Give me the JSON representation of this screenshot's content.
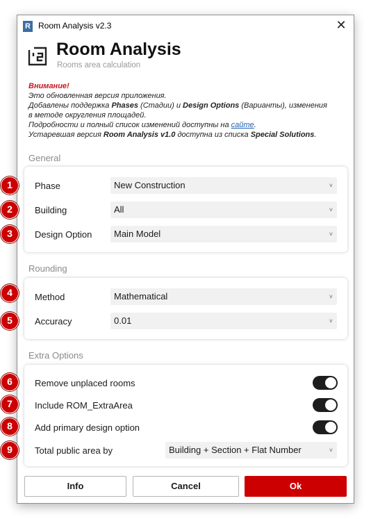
{
  "window": {
    "title": "Room Analysis v2.3",
    "app_icon_letter": "R",
    "close_glyph": "✕"
  },
  "header": {
    "title": "Room Analysis",
    "subtitle": "Rooms area calculation"
  },
  "notice": {
    "warning": "Внимание!",
    "line1": "Это обновленная версия приложения.",
    "line2_a": "Добавлены поддержка ",
    "line2_b": "Phases",
    "line2_c": " (Стадии) и ",
    "line2_d": "Design Options",
    "line2_e": " (Варианты), изменения",
    "line3": "в методе округления площадей.",
    "line4_a": "Подробности и полный список изменений доступны на ",
    "line4_link": "сайте",
    "line4_b": ".",
    "line5_a": "Устаревшая версия ",
    "line5_b": "Room Analysis v1.0",
    "line5_c": " доступна из списка ",
    "line5_d": "Special Solutions",
    "line5_e": "."
  },
  "general": {
    "section_label": "General",
    "phase": {
      "label": "Phase",
      "value": "New Construction"
    },
    "building": {
      "label": "Building",
      "value": "All"
    },
    "design_option": {
      "label": "Design Option",
      "value": "Main Model"
    }
  },
  "rounding": {
    "section_label": "Rounding",
    "method": {
      "label": "Method",
      "value": "Mathematical"
    },
    "accuracy": {
      "label": "Accuracy",
      "value": "0.01"
    }
  },
  "extra": {
    "section_label": "Extra Options",
    "remove_unplaced": {
      "label": "Remove unplaced rooms",
      "on": true
    },
    "include_rom": {
      "label": "Include ROM_ExtraArea",
      "on": true
    },
    "add_primary": {
      "label": "Add primary design option",
      "on": true
    },
    "total_public": {
      "label": "Total public area by",
      "value": "Building + Section + Flat Number"
    }
  },
  "buttons": {
    "info": "Info",
    "cancel": "Cancel",
    "ok": "Ok"
  },
  "badges": [
    "1",
    "2",
    "3",
    "4",
    "5",
    "6",
    "7",
    "8",
    "9"
  ],
  "chevron_glyph": "˅",
  "colors": {
    "accent": "#cc0000",
    "warning": "#c8161d",
    "link": "#1a5fb4",
    "toggle_on": "#1d1d1d"
  }
}
